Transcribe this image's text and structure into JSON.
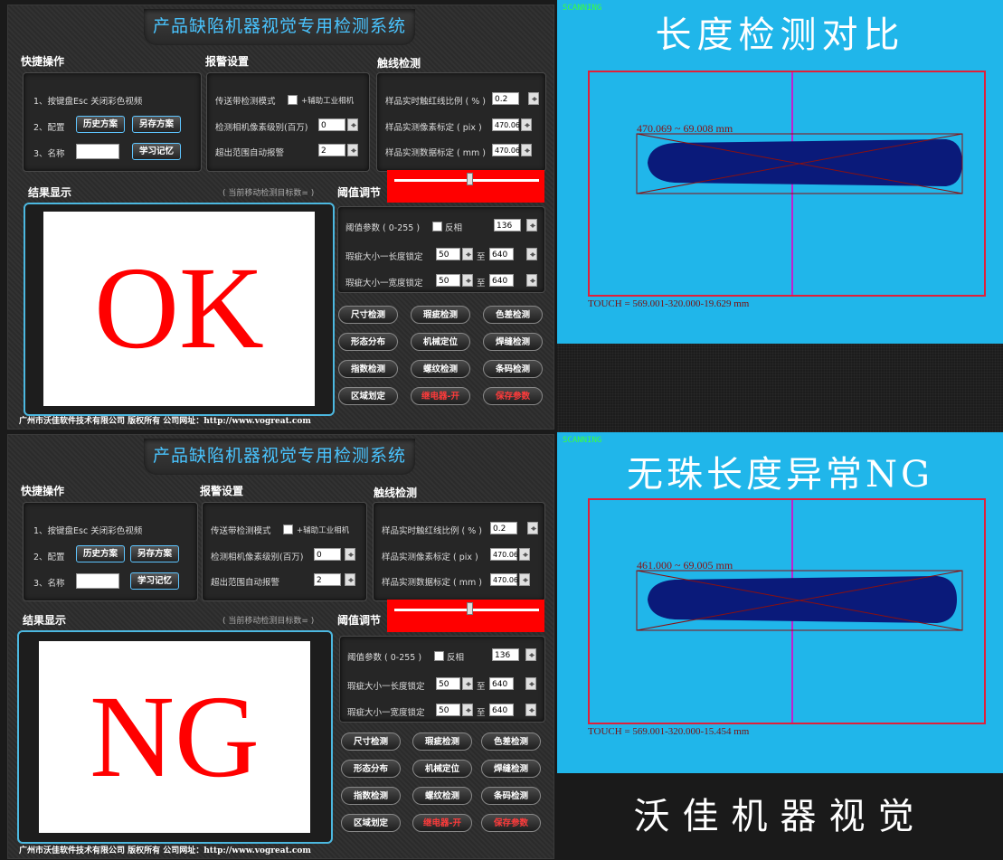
{
  "panels": [
    {
      "title": "产品缺陷机器视觉专用检测系统",
      "quick": {
        "label": "快捷操作",
        "row1": "1、按键盘Esc  关闭彩色视频",
        "row2_prefix": "2、配置",
        "history_btn": "历史方案",
        "saveas_btn": "另存方案",
        "row3_prefix": "3、名称",
        "name_value": "",
        "learn_btn": "学习记忆"
      },
      "alarm": {
        "label": "报警设置",
        "conveyor": "传送带检测模式",
        "aux_camera": "+辅助工业相机",
        "pixel_level": "检测相机像素级别(百万)",
        "pixel_level_value": "0",
        "auto_alarm": "超出范围自动报警",
        "auto_alarm_value": "2"
      },
      "touch": {
        "label": "触线检测",
        "ratio": "样品实时触红线比例 ( % )",
        "ratio_value": "0.2",
        "pix": "样品实测像素标定 ( pix )",
        "pix_value": "470.06",
        "mm": "样品实测数据标定 ( mm )",
        "mm_value": "470.06"
      },
      "result_label": "结果显示",
      "target_count": "( 当前移动检测目标数= )",
      "threshold_label": "阈值调节",
      "threshold": {
        "param": "阈值参数 ( 0-255 )",
        "invert": "反相",
        "param_value": "136",
        "len_lock": "瑕疵大小一长度锁定",
        "len_from": "50",
        "to1": "至",
        "len_to": "640",
        "wid_lock": "瑕疵大小一宽度锁定",
        "wid_from": "50",
        "to2": "至",
        "wid_to": "640"
      },
      "result": "OK",
      "buttons": [
        "尺寸检测",
        "瑕疵检测",
        "色差检测",
        "形态分布",
        "机械定位",
        "焊缝检测",
        "指数检测",
        "螺纹检测",
        "条码检测",
        "区域划定",
        "继电器-开",
        "保存参数"
      ],
      "footer": "广州市沃佳软件技术有限公司 版权所有 公司网址：http://www.vogreat.com"
    },
    {
      "title": "产品缺陷机器视觉专用检测系统",
      "quick": {
        "label": "快捷操作",
        "row1": "1、按键盘Esc  关闭彩色视频",
        "row2_prefix": "2、配置",
        "history_btn": "历史方案",
        "saveas_btn": "另存方案",
        "row3_prefix": "3、名称",
        "name_value": "",
        "learn_btn": "学习记忆"
      },
      "alarm": {
        "label": "报警设置",
        "conveyor": "传送带检测模式",
        "aux_camera": "+辅助工业相机",
        "pixel_level": "检测相机像素级别(百万)",
        "pixel_level_value": "0",
        "auto_alarm": "超出范围自动报警",
        "auto_alarm_value": "2"
      },
      "touch": {
        "label": "触线检测",
        "ratio": "样品实时触红线比例 ( % )",
        "ratio_value": "0.2",
        "pix": "样品实测像素标定 ( pix )",
        "pix_value": "470.06",
        "mm": "样品实测数据标定 ( mm )",
        "mm_value": "470.06"
      },
      "result_label": "结果显示",
      "target_count": "( 当前移动检测目标数= )",
      "threshold_label": "阈值调节",
      "threshold": {
        "param": "阈值参数 ( 0-255 )",
        "invert": "反相",
        "param_value": "136",
        "len_lock": "瑕疵大小一长度锁定",
        "len_from": "50",
        "to1": "至",
        "len_to": "640",
        "wid_lock": "瑕疵大小一宽度锁定",
        "wid_from": "50",
        "to2": "至",
        "wid_to": "640"
      },
      "result": "NG",
      "buttons": [
        "尺寸检测",
        "瑕疵检测",
        "色差检测",
        "形态分布",
        "机械定位",
        "焊缝检测",
        "指数检测",
        "螺纹检测",
        "条码检测",
        "区域划定",
        "继电器-开",
        "保存参数"
      ],
      "footer": "广州市沃佳软件技术有限公司 版权所有 公司网址：http://www.vogreat.com"
    }
  ],
  "images": [
    {
      "title": "长度检测对比",
      "measure": "470.069 ~ 69.008 mm",
      "touch": "TOUCH = 569.001-320.000-19.629 mm"
    },
    {
      "title": "无珠长度异常NG",
      "measure": "461.000 ~ 69.005 mm",
      "touch": "TOUCH = 569.001-320.000-15.454 mm"
    }
  ],
  "brand": "沃佳机器视觉",
  "colors": {
    "accent": "#49c4ff",
    "result": "#ff0000",
    "image_bg": "#20b6ea",
    "roi": "#e0203a",
    "center_line": "#c020d0"
  }
}
